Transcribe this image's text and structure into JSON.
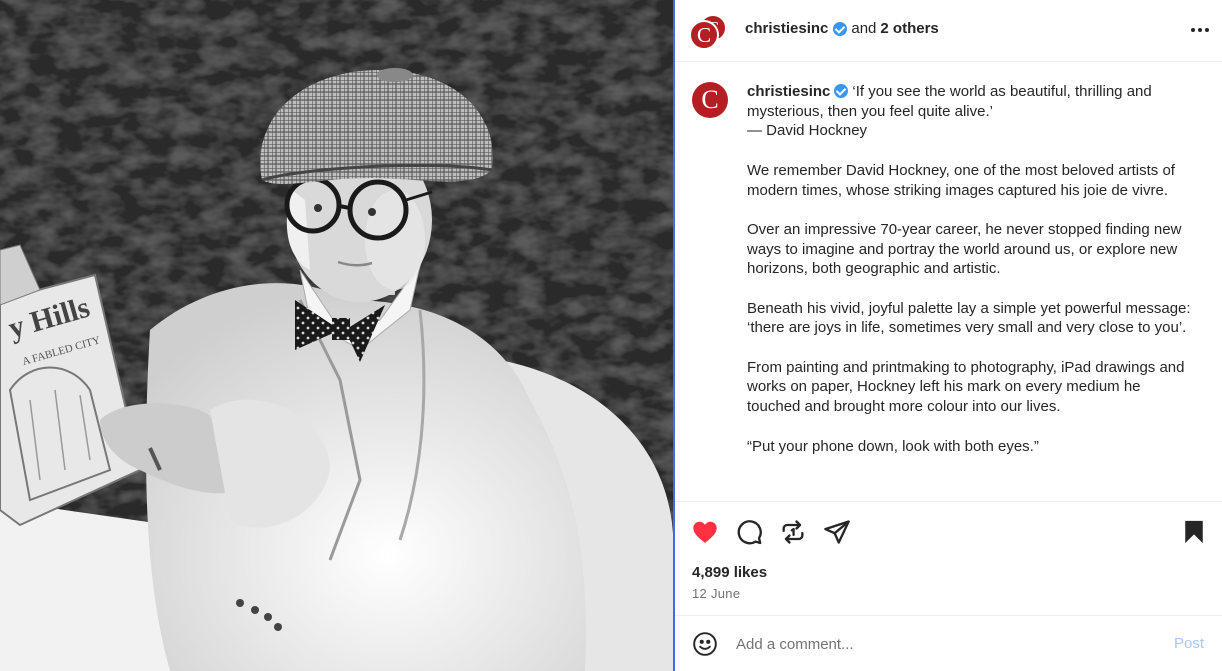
{
  "post": {
    "header": {
      "username": "christiesinc",
      "and_text": "and",
      "others_text": "2 others",
      "avatar_letter": "C",
      "more_icon": "more-horizontal-icon"
    },
    "caption": {
      "username": "christiesinc",
      "avatar_letter": "C",
      "paragraphs": [
        "‘If you see the world as beautiful, thrilling and mysterious, then you feel quite alive.’\n— David Hockney",
        "We remember David Hockney, one of the most beloved artists of modern times, whose striking images captured his joie de vivre.",
        "Over an impressive 70-year career, he never stopped finding new ways to imagine and portray the world around us, or explore new horizons, both geographic and artistic.",
        "Beneath his vivid, joyful palette lay a simple yet powerful message: ‘there are joys in life, sometimes very small and very close to you’.",
        "From painting and printmaking to photography, iPad drawings and works on paper, Hockney left his mark on every medium he touched and brought more colour into our lives.",
        "“Put your phone down, look with both eyes.”"
      ]
    },
    "actions": {
      "like_icon": "heart-filled-icon",
      "comment_icon": "comment-icon",
      "repost_icon": "repost-icon",
      "share_icon": "send-icon",
      "save_icon": "bookmark-filled-icon",
      "liked": true,
      "saved": true
    },
    "likes_text": "4,899 likes",
    "date_text": "12 June",
    "comment": {
      "placeholder": "Add a comment...",
      "post_label": "Post",
      "emoji_icon": "emoji-icon"
    }
  },
  "colors": {
    "brand_red": "#b51f24",
    "like_red": "#ff3040",
    "verified_blue": "#3897f0",
    "post_button": "#a8c7fa"
  }
}
